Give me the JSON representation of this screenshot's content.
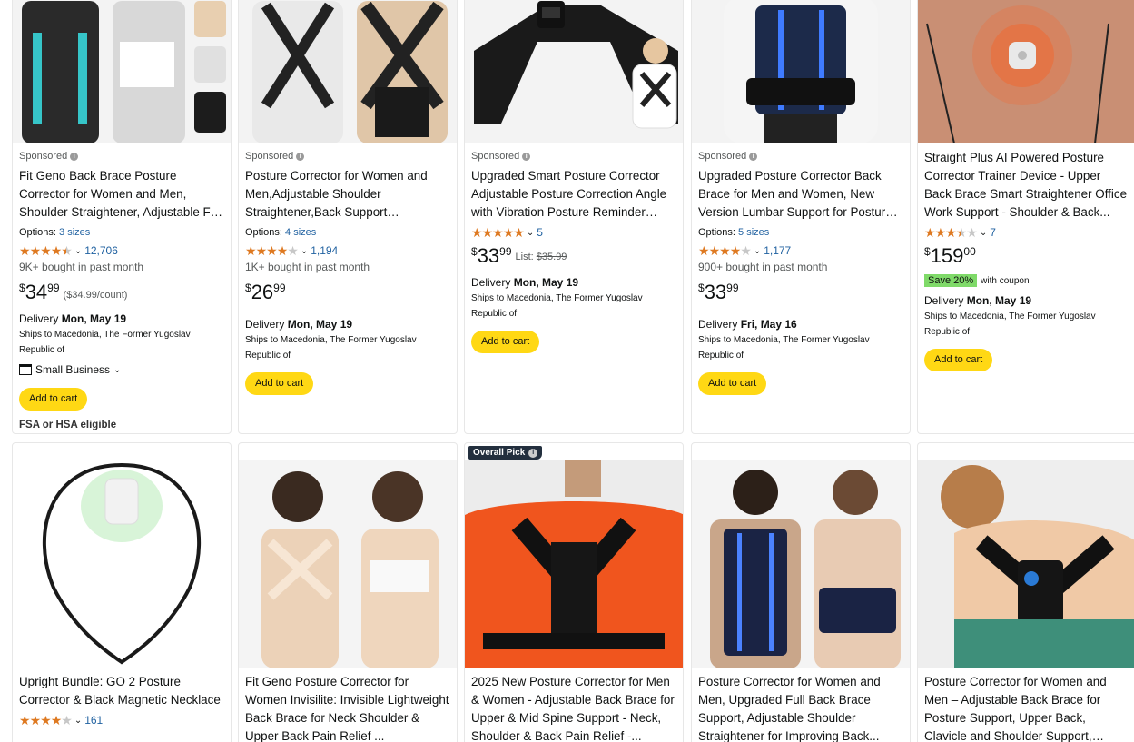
{
  "row1": [
    {
      "sponsored": "Sponsored",
      "title": "Fit Geno Back Brace Posture Corrector for Women and Men, Shoulder Straightener, Adjustable Full Back Support",
      "options_label": "Options:",
      "options_link": "3 sizes",
      "rating": 4.3,
      "rating_count": "12,706",
      "bought": "9K+ bought in past month",
      "price_symbol": "$",
      "price_whole": "34",
      "price_fraction": "99",
      "unit_price": "($34.99/count)",
      "delivery_label": "Delivery",
      "delivery_date": "Mon, May 19",
      "ships": "Ships to Macedonia, The Former Yugoslav Republic of",
      "small_business": "Small Business",
      "button": "Add to cart",
      "fsa": "FSA or HSA eligible"
    },
    {
      "sponsored": "Sponsored",
      "title": "Posture Corrector for Women and Men,Adjustable Shoulder Straightener,Back Support Brace,Upper Spine scoliosis, Hunchback",
      "options_label": "Options:",
      "options_link": "4 sizes",
      "rating": 4.1,
      "rating_count": "1,194",
      "bought": "1K+ bought in past month",
      "price_symbol": "$",
      "price_whole": "26",
      "price_fraction": "99",
      "delivery_label": "Delivery",
      "delivery_date": "Mon, May 19",
      "ships": "Ships to Macedonia, The Former Yugoslav Republic of",
      "button": "Add to cart"
    },
    {
      "sponsored": "Sponsored",
      "title": "Upgraded Smart Posture Corrector Adjustable Posture Correction Angle with Vibration Posture Reminder Correct Hunchback Posture...",
      "rating": 5.0,
      "rating_count": "5",
      "price_symbol": "$",
      "price_whole": "33",
      "price_fraction": "99",
      "list_label": "List:",
      "list_price": "$35.99",
      "delivery_label": "Delivery",
      "delivery_date": "Mon, May 19",
      "ships": "Ships to Macedonia, The Former Yugoslav Republic of",
      "button": "Add to cart"
    },
    {
      "sponsored": "Sponsored",
      "title": "Upgraded Posture Corrector Back Brace for Men and Women, New Version Lumbar Support for Posture Improving and Pain Relief, Full Back...",
      "options_label": "Options:",
      "options_link": "5 sizes",
      "rating": 4.1,
      "rating_count": "1,177",
      "bought": "900+ bought in past month",
      "price_symbol": "$",
      "price_whole": "33",
      "price_fraction": "99",
      "delivery_label": "Delivery",
      "delivery_date": "Fri, May 16",
      "ships": "Ships to Macedonia, The Former Yugoslav Republic of",
      "button": "Add to cart"
    },
    {
      "title": "Straight Plus AI Powered Posture Corrector Trainer Device - Upper Back Brace Smart Straightener Office Work Support - Shoulder & Back...",
      "rating": 3.6,
      "rating_count": "7",
      "price_symbol": "$",
      "price_whole": "159",
      "price_fraction": "00",
      "save_badge": "Save 20%",
      "save_text": "with coupon",
      "delivery_label": "Delivery",
      "delivery_date": "Mon, May 19",
      "ships": "Ships to Macedonia, The Former Yugoslav Republic of",
      "button": "Add to cart"
    }
  ],
  "row2": [
    {
      "title": "Upright Bundle: GO 2 Posture Corrector & Black Magnetic Necklace",
      "rating": 4.2,
      "rating_count": "161"
    },
    {
      "title": "Fit Geno Posture Corrector for Women Invisilite: Invisible Lightweight Back Brace for Neck Shoulder & Upper Back Pain Relief ..."
    },
    {
      "badge": "Overall Pick",
      "title": "2025 New Posture Corrector for Men & Women - Adjustable Back Brace for Upper & Mid Spine Support - Neck, Shoulder & Back Pain Relief -..."
    },
    {
      "title": "Posture Corrector for Women and Men, Upgraded Full Back Brace Support, Adjustable Shoulder Straightener for Improving Back..."
    },
    {
      "title": "Posture Corrector for Women and Men – Adjustable Back Brace for Posture Support, Upper Back, Clavicle and Shoulder Support, Comfortabl..."
    }
  ],
  "colors": {
    "button": "#ffd814",
    "link": "#2162a1",
    "star": "#de7921",
    "save_badge": "#7fda69"
  }
}
